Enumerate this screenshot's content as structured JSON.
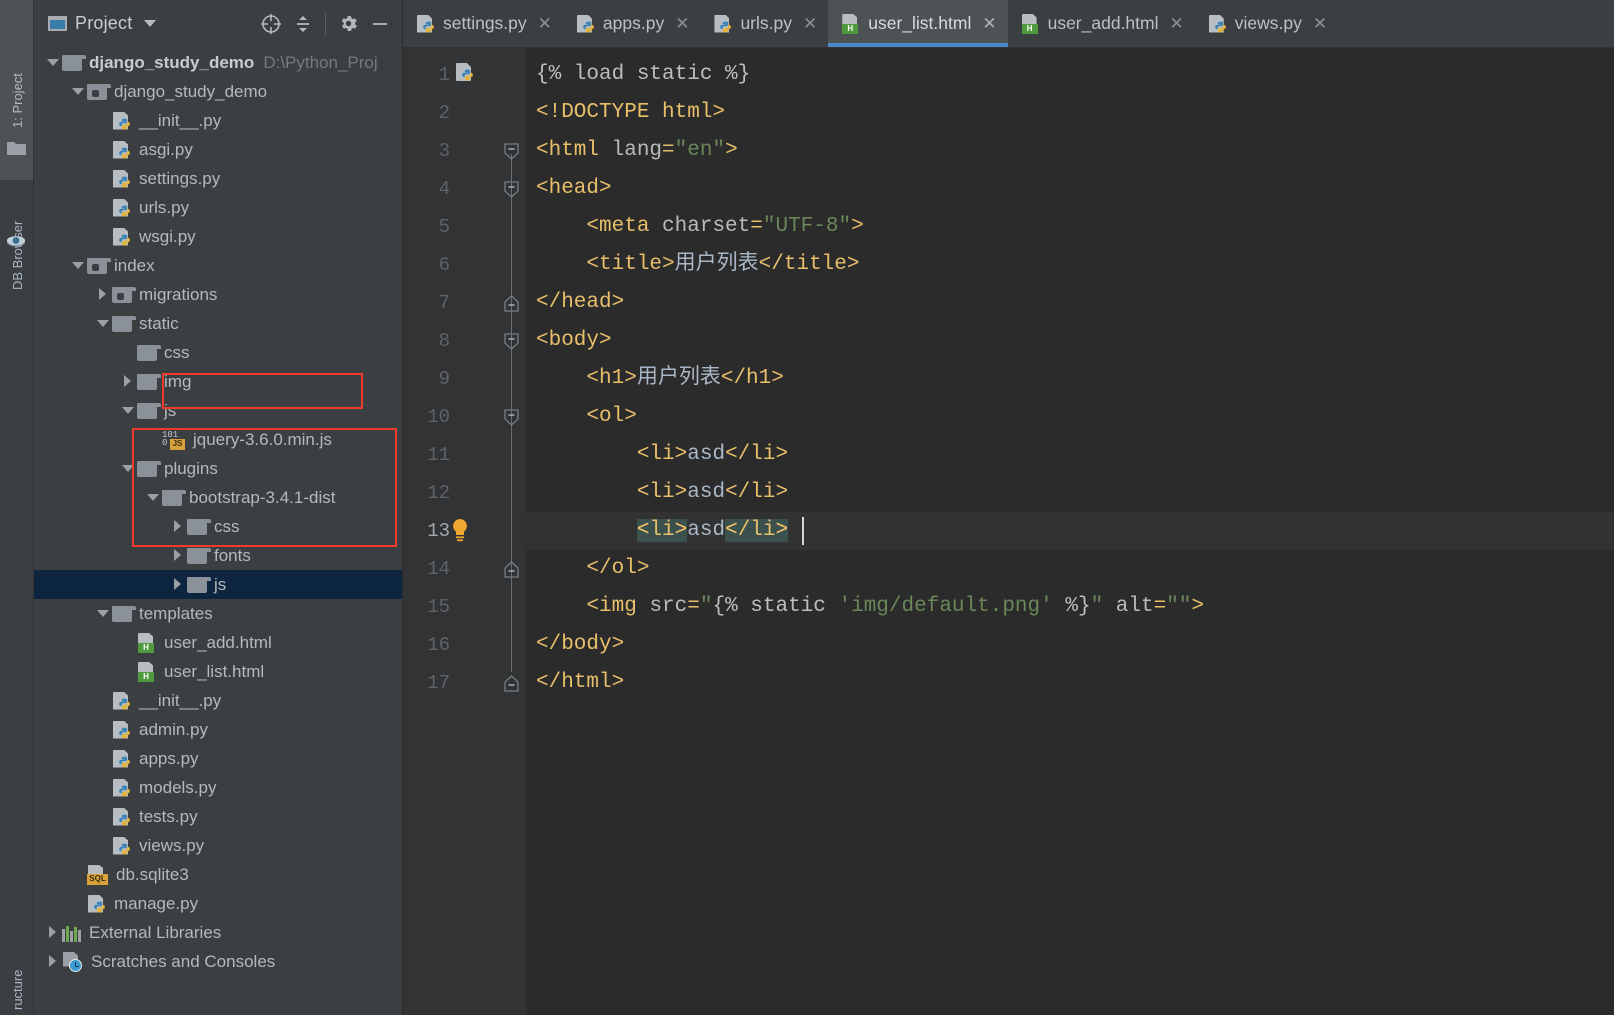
{
  "left_toolstrip": {
    "tabs": [
      {
        "label": "1: Project",
        "icon": "project-icon"
      },
      {
        "label": "DB Browser",
        "icon": "database-icon"
      },
      {
        "label": "ructure",
        "icon": "structure-icon"
      }
    ]
  },
  "project_pane": {
    "title": "Project",
    "window_icon": "project-window-icon",
    "dropdown_icon": "chevron-down-icon",
    "actions": [
      {
        "name": "select-opened-file-icon",
        "tooltip": "Select Opened File"
      },
      {
        "name": "collapse-all-icon",
        "tooltip": "Collapse All"
      },
      {
        "name": "settings-gear-icon",
        "tooltip": "Settings"
      },
      {
        "name": "hide-panel-icon",
        "tooltip": "Hide"
      }
    ],
    "tree": [
      {
        "label": "django_study_demo",
        "hint": "D:\\Python_Proj",
        "icon": "folder",
        "indent": 0,
        "arrow": "down",
        "bold": true
      },
      {
        "label": "django_study_demo",
        "hint": "",
        "icon": "folder-module",
        "indent": 1,
        "arrow": "down",
        "bold": false
      },
      {
        "label": "__init__.py",
        "hint": "",
        "icon": "python-file",
        "indent": 2,
        "arrow": "none",
        "bold": false
      },
      {
        "label": "asgi.py",
        "hint": "",
        "icon": "python-file",
        "indent": 2,
        "arrow": "none",
        "bold": false
      },
      {
        "label": "settings.py",
        "hint": "",
        "icon": "python-file",
        "indent": 2,
        "arrow": "none",
        "bold": false
      },
      {
        "label": "urls.py",
        "hint": "",
        "icon": "python-file",
        "indent": 2,
        "arrow": "none",
        "bold": false
      },
      {
        "label": "wsgi.py",
        "hint": "",
        "icon": "python-file",
        "indent": 2,
        "arrow": "none",
        "bold": false
      },
      {
        "label": "index",
        "hint": "",
        "icon": "folder-module",
        "indent": 1,
        "arrow": "down",
        "bold": false
      },
      {
        "label": "migrations",
        "hint": "",
        "icon": "folder-module",
        "indent": 2,
        "arrow": "right",
        "bold": false
      },
      {
        "label": "static",
        "hint": "",
        "icon": "folder",
        "indent": 2,
        "arrow": "down",
        "bold": false
      },
      {
        "label": "css",
        "hint": "",
        "icon": "folder",
        "indent": 3,
        "arrow": "none",
        "bold": false
      },
      {
        "label": "img",
        "hint": "",
        "icon": "folder",
        "indent": 3,
        "arrow": "right",
        "bold": false
      },
      {
        "label": "js",
        "hint": "",
        "icon": "folder",
        "indent": 3,
        "arrow": "down",
        "bold": false
      },
      {
        "label": "jquery-3.6.0.min.js",
        "hint": "",
        "icon": "js-file",
        "indent": 4,
        "arrow": "none",
        "bold": false
      },
      {
        "label": "plugins",
        "hint": "",
        "icon": "folder",
        "indent": 3,
        "arrow": "down",
        "bold": false
      },
      {
        "label": "bootstrap-3.4.1-dist",
        "hint": "",
        "icon": "folder",
        "indent": 4,
        "arrow": "down",
        "bold": false
      },
      {
        "label": "css",
        "hint": "",
        "icon": "folder",
        "indent": 5,
        "arrow": "right",
        "bold": false
      },
      {
        "label": "fonts",
        "hint": "",
        "icon": "folder",
        "indent": 5,
        "arrow": "right",
        "bold": false
      },
      {
        "label": "js",
        "hint": "",
        "icon": "folder",
        "indent": 5,
        "arrow": "right",
        "bold": false,
        "selected": true
      },
      {
        "label": "templates",
        "hint": "",
        "icon": "folder",
        "indent": 2,
        "arrow": "down",
        "bold": false
      },
      {
        "label": "user_add.html",
        "hint": "",
        "icon": "html-file",
        "indent": 3,
        "arrow": "none",
        "bold": false
      },
      {
        "label": "user_list.html",
        "hint": "",
        "icon": "html-file",
        "indent": 3,
        "arrow": "none",
        "bold": false
      },
      {
        "label": "__init__.py",
        "hint": "",
        "icon": "python-file",
        "indent": 2,
        "arrow": "none",
        "bold": false
      },
      {
        "label": "admin.py",
        "hint": "",
        "icon": "python-file",
        "indent": 2,
        "arrow": "none",
        "bold": false
      },
      {
        "label": "apps.py",
        "hint": "",
        "icon": "python-file",
        "indent": 2,
        "arrow": "none",
        "bold": false
      },
      {
        "label": "models.py",
        "hint": "",
        "icon": "python-file",
        "indent": 2,
        "arrow": "none",
        "bold": false
      },
      {
        "label": "tests.py",
        "hint": "",
        "icon": "python-file",
        "indent": 2,
        "arrow": "none",
        "bold": false
      },
      {
        "label": "views.py",
        "hint": "",
        "icon": "python-file",
        "indent": 2,
        "arrow": "none",
        "bold": false
      },
      {
        "label": "db.sqlite3",
        "hint": "",
        "icon": "sql-file",
        "indent": 1,
        "arrow": "none",
        "bold": false
      },
      {
        "label": "manage.py",
        "hint": "",
        "icon": "python-file",
        "indent": 1,
        "arrow": "none",
        "bold": false
      },
      {
        "label": "External Libraries",
        "hint": "",
        "icon": "libraries-icon",
        "indent": 0,
        "arrow": "right",
        "bold": false
      },
      {
        "label": "Scratches and Consoles",
        "hint": "",
        "icon": "scratches-icon",
        "indent": 0,
        "arrow": "right",
        "bold": false
      }
    ],
    "annotations": [
      {
        "name": "highlight-jquery",
        "color": "#ef3b2d"
      },
      {
        "name": "highlight-bootstrap-dist",
        "color": "#ef3b2d"
      }
    ]
  },
  "editor_tabs": [
    {
      "label": "settings.py",
      "icon": "python-file",
      "active": false,
      "close_icon": "close-icon"
    },
    {
      "label": "apps.py",
      "icon": "python-file",
      "active": false,
      "close_icon": "close-icon"
    },
    {
      "label": "urls.py",
      "icon": "python-file",
      "active": false,
      "close_icon": "close-icon"
    },
    {
      "label": "user_list.html",
      "icon": "html-file",
      "active": true,
      "close_icon": "close-icon"
    },
    {
      "label": "user_add.html",
      "icon": "html-file",
      "active": false,
      "close_icon": "close-icon"
    },
    {
      "label": "views.py",
      "icon": "python-file",
      "active": false,
      "close_icon": "close-icon"
    }
  ],
  "editor": {
    "active_line": 13,
    "gutter_icon_line1": "django-python-icon",
    "inspection_bulb_line": 13,
    "accent_color": "#4a88c7",
    "lines": [
      {
        "n": 1,
        "text": "{% load static %}"
      },
      {
        "n": 2,
        "text": "<!DOCTYPE html>"
      },
      {
        "n": 3,
        "text": "<html lang=\"en\">"
      },
      {
        "n": 4,
        "text": "<head>"
      },
      {
        "n": 5,
        "text": "    <meta charset=\"UTF-8\">"
      },
      {
        "n": 6,
        "text": "    <title>用户列表</title>"
      },
      {
        "n": 7,
        "text": "</head>"
      },
      {
        "n": 8,
        "text": "<body>"
      },
      {
        "n": 9,
        "text": "    <h1>用户列表</h1>"
      },
      {
        "n": 10,
        "text": "    <ol>"
      },
      {
        "n": 11,
        "text": "        <li>asd</li>"
      },
      {
        "n": 12,
        "text": "        <li>asd</li>"
      },
      {
        "n": 13,
        "text": "        <li>asd</li>"
      },
      {
        "n": 14,
        "text": "    </ol>"
      },
      {
        "n": 15,
        "text": "    <img src=\"{% static 'img/default.png' %}\" alt=\"\">"
      },
      {
        "n": 16,
        "text": "</body>"
      },
      {
        "n": 17,
        "text": "</html>"
      }
    ]
  }
}
